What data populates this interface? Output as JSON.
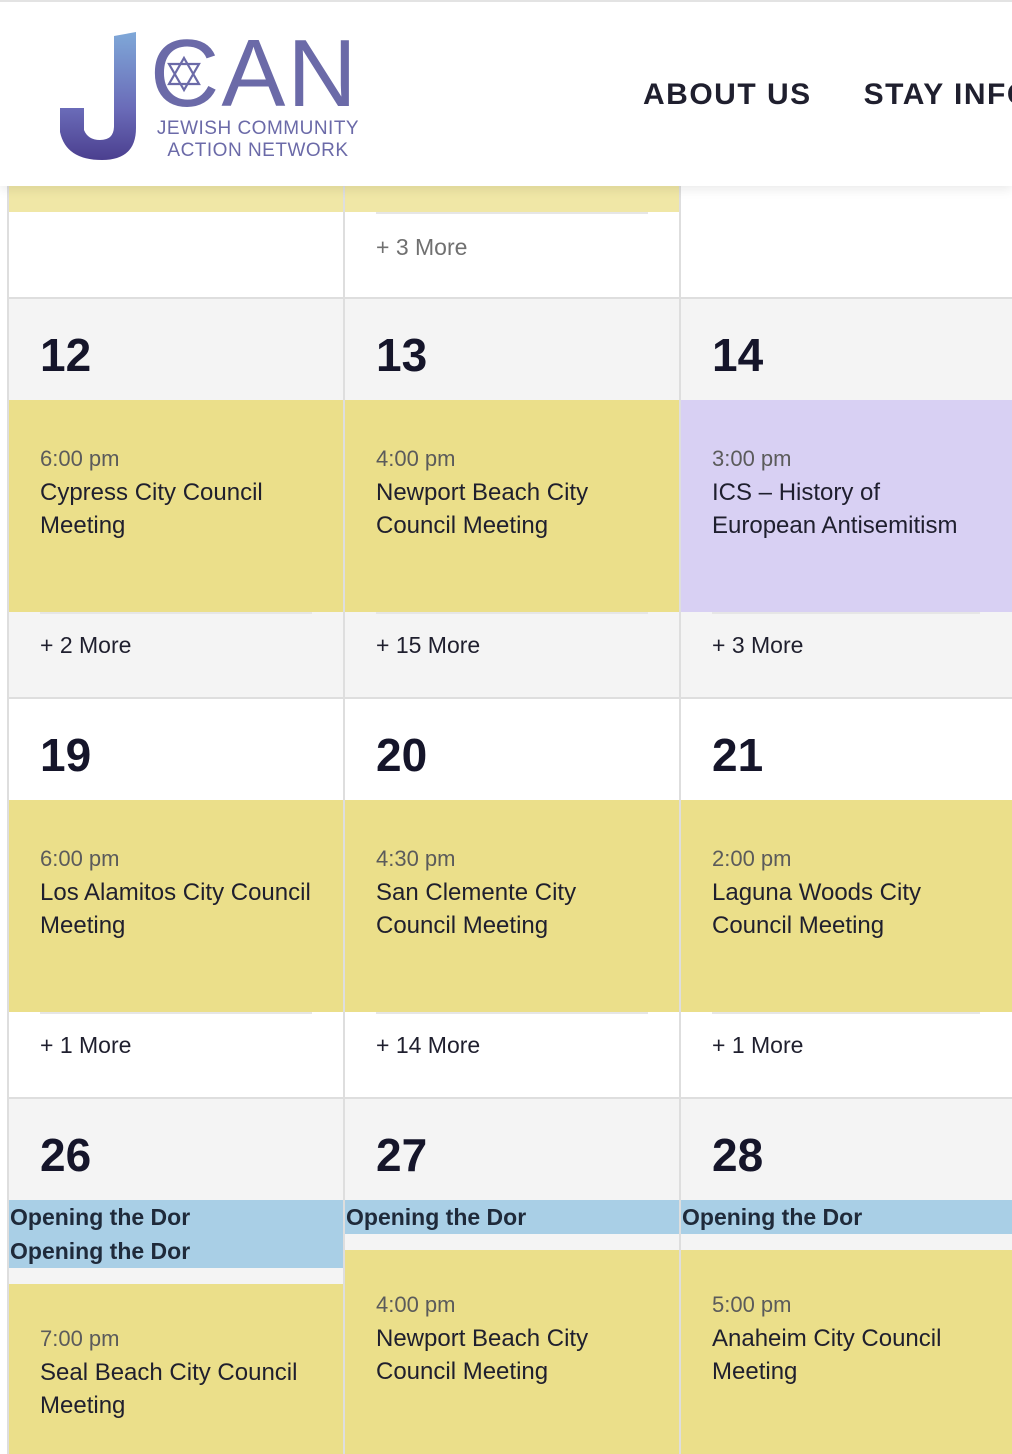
{
  "header": {
    "logo": {
      "letter": "J",
      "name": "CAN",
      "subtitle_line1": "JEWISH COMMUNITY",
      "subtitle_line2": "ACTION NETWORK",
      "color": "#6b6aa8"
    },
    "nav": [
      {
        "label": "ABOUT US"
      },
      {
        "label": "STAY INFO"
      }
    ]
  },
  "calendar": {
    "top_row": {
      "more_label": "+ 3 More"
    },
    "weeks": [
      {
        "days": [
          {
            "num": "12",
            "time": "6:00 pm",
            "title": "Cypress City Council Meeting",
            "more": "+ 2 More"
          },
          {
            "num": "13",
            "time": "4:00 pm",
            "title": "Newport Beach City Council Meeting",
            "more": "+ 15 More"
          },
          {
            "num": "14",
            "time": "3:00 pm",
            "title": "ICS – History of European Antisemitism",
            "more": "+ 3 More"
          }
        ]
      },
      {
        "days": [
          {
            "num": "19",
            "time": "6:00 pm",
            "title": "Los Alamitos City Council Meeting",
            "more": "+ 1 More"
          },
          {
            "num": "20",
            "time": "4:30 pm",
            "title": "San Clemente City Council Meeting",
            "more": "+ 14 More"
          },
          {
            "num": "21",
            "time": "2:00 pm",
            "title": "Laguna Woods City Council Meeting",
            "more": "+ 1 More"
          }
        ]
      },
      {
        "days": [
          {
            "num": "26",
            "banners": [
              "Opening the Dor",
              "Opening the Dor"
            ],
            "time": "7:00 pm",
            "title": "Seal Beach City Council Meeting"
          },
          {
            "num": "27",
            "banners": [
              "Opening the Dor"
            ],
            "time": "4:00 pm",
            "title": "Newport Beach City Council Meeting"
          },
          {
            "num": "28",
            "banners": [
              "Opening the Dor"
            ],
            "time": "5:00 pm",
            "title": "Anaheim City Council Meeting"
          }
        ]
      }
    ]
  },
  "colors": {
    "event_yellow": "#ebdf8a",
    "event_purple": "#d8d0f3",
    "banner_blue": "#a9cfe6"
  }
}
